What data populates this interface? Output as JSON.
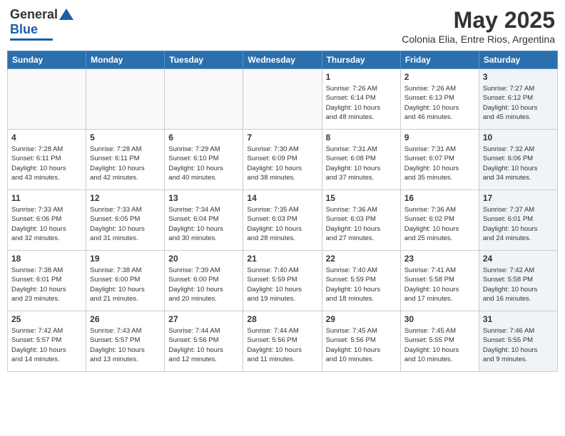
{
  "header": {
    "logo_general": "General",
    "logo_blue": "Blue",
    "title": "May 2025",
    "subtitle": "Colonia Elia, Entre Rios, Argentina"
  },
  "days_of_week": [
    "Sunday",
    "Monday",
    "Tuesday",
    "Wednesday",
    "Thursday",
    "Friday",
    "Saturday"
  ],
  "weeks": [
    [
      {
        "day": "",
        "info": ""
      },
      {
        "day": "",
        "info": ""
      },
      {
        "day": "",
        "info": ""
      },
      {
        "day": "",
        "info": ""
      },
      {
        "day": "1",
        "info": "Sunrise: 7:26 AM\nSunset: 6:14 PM\nDaylight: 10 hours\nand 48 minutes."
      },
      {
        "day": "2",
        "info": "Sunrise: 7:26 AM\nSunset: 6:13 PM\nDaylight: 10 hours\nand 46 minutes."
      },
      {
        "day": "3",
        "info": "Sunrise: 7:27 AM\nSunset: 6:12 PM\nDaylight: 10 hours\nand 45 minutes."
      }
    ],
    [
      {
        "day": "4",
        "info": "Sunrise: 7:28 AM\nSunset: 6:11 PM\nDaylight: 10 hours\nand 43 minutes."
      },
      {
        "day": "5",
        "info": "Sunrise: 7:28 AM\nSunset: 6:11 PM\nDaylight: 10 hours\nand 42 minutes."
      },
      {
        "day": "6",
        "info": "Sunrise: 7:29 AM\nSunset: 6:10 PM\nDaylight: 10 hours\nand 40 minutes."
      },
      {
        "day": "7",
        "info": "Sunrise: 7:30 AM\nSunset: 6:09 PM\nDaylight: 10 hours\nand 38 minutes."
      },
      {
        "day": "8",
        "info": "Sunrise: 7:31 AM\nSunset: 6:08 PM\nDaylight: 10 hours\nand 37 minutes."
      },
      {
        "day": "9",
        "info": "Sunrise: 7:31 AM\nSunset: 6:07 PM\nDaylight: 10 hours\nand 35 minutes."
      },
      {
        "day": "10",
        "info": "Sunrise: 7:32 AM\nSunset: 6:06 PM\nDaylight: 10 hours\nand 34 minutes."
      }
    ],
    [
      {
        "day": "11",
        "info": "Sunrise: 7:33 AM\nSunset: 6:06 PM\nDaylight: 10 hours\nand 32 minutes."
      },
      {
        "day": "12",
        "info": "Sunrise: 7:33 AM\nSunset: 6:05 PM\nDaylight: 10 hours\nand 31 minutes."
      },
      {
        "day": "13",
        "info": "Sunrise: 7:34 AM\nSunset: 6:04 PM\nDaylight: 10 hours\nand 30 minutes."
      },
      {
        "day": "14",
        "info": "Sunrise: 7:35 AM\nSunset: 6:03 PM\nDaylight: 10 hours\nand 28 minutes."
      },
      {
        "day": "15",
        "info": "Sunrise: 7:36 AM\nSunset: 6:03 PM\nDaylight: 10 hours\nand 27 minutes."
      },
      {
        "day": "16",
        "info": "Sunrise: 7:36 AM\nSunset: 6:02 PM\nDaylight: 10 hours\nand 25 minutes."
      },
      {
        "day": "17",
        "info": "Sunrise: 7:37 AM\nSunset: 6:01 PM\nDaylight: 10 hours\nand 24 minutes."
      }
    ],
    [
      {
        "day": "18",
        "info": "Sunrise: 7:38 AM\nSunset: 6:01 PM\nDaylight: 10 hours\nand 23 minutes."
      },
      {
        "day": "19",
        "info": "Sunrise: 7:38 AM\nSunset: 6:00 PM\nDaylight: 10 hours\nand 21 minutes."
      },
      {
        "day": "20",
        "info": "Sunrise: 7:39 AM\nSunset: 6:00 PM\nDaylight: 10 hours\nand 20 minutes."
      },
      {
        "day": "21",
        "info": "Sunrise: 7:40 AM\nSunset: 5:59 PM\nDaylight: 10 hours\nand 19 minutes."
      },
      {
        "day": "22",
        "info": "Sunrise: 7:40 AM\nSunset: 5:59 PM\nDaylight: 10 hours\nand 18 minutes."
      },
      {
        "day": "23",
        "info": "Sunrise: 7:41 AM\nSunset: 5:58 PM\nDaylight: 10 hours\nand 17 minutes."
      },
      {
        "day": "24",
        "info": "Sunrise: 7:42 AM\nSunset: 5:58 PM\nDaylight: 10 hours\nand 16 minutes."
      }
    ],
    [
      {
        "day": "25",
        "info": "Sunrise: 7:42 AM\nSunset: 5:57 PM\nDaylight: 10 hours\nand 14 minutes."
      },
      {
        "day": "26",
        "info": "Sunrise: 7:43 AM\nSunset: 5:57 PM\nDaylight: 10 hours\nand 13 minutes."
      },
      {
        "day": "27",
        "info": "Sunrise: 7:44 AM\nSunset: 5:56 PM\nDaylight: 10 hours\nand 12 minutes."
      },
      {
        "day": "28",
        "info": "Sunrise: 7:44 AM\nSunset: 5:56 PM\nDaylight: 10 hours\nand 11 minutes."
      },
      {
        "day": "29",
        "info": "Sunrise: 7:45 AM\nSunset: 5:56 PM\nDaylight: 10 hours\nand 10 minutes."
      },
      {
        "day": "30",
        "info": "Sunrise: 7:45 AM\nSunset: 5:55 PM\nDaylight: 10 hours\nand 10 minutes."
      },
      {
        "day": "31",
        "info": "Sunrise: 7:46 AM\nSunset: 5:55 PM\nDaylight: 10 hours\nand 9 minutes."
      }
    ]
  ]
}
